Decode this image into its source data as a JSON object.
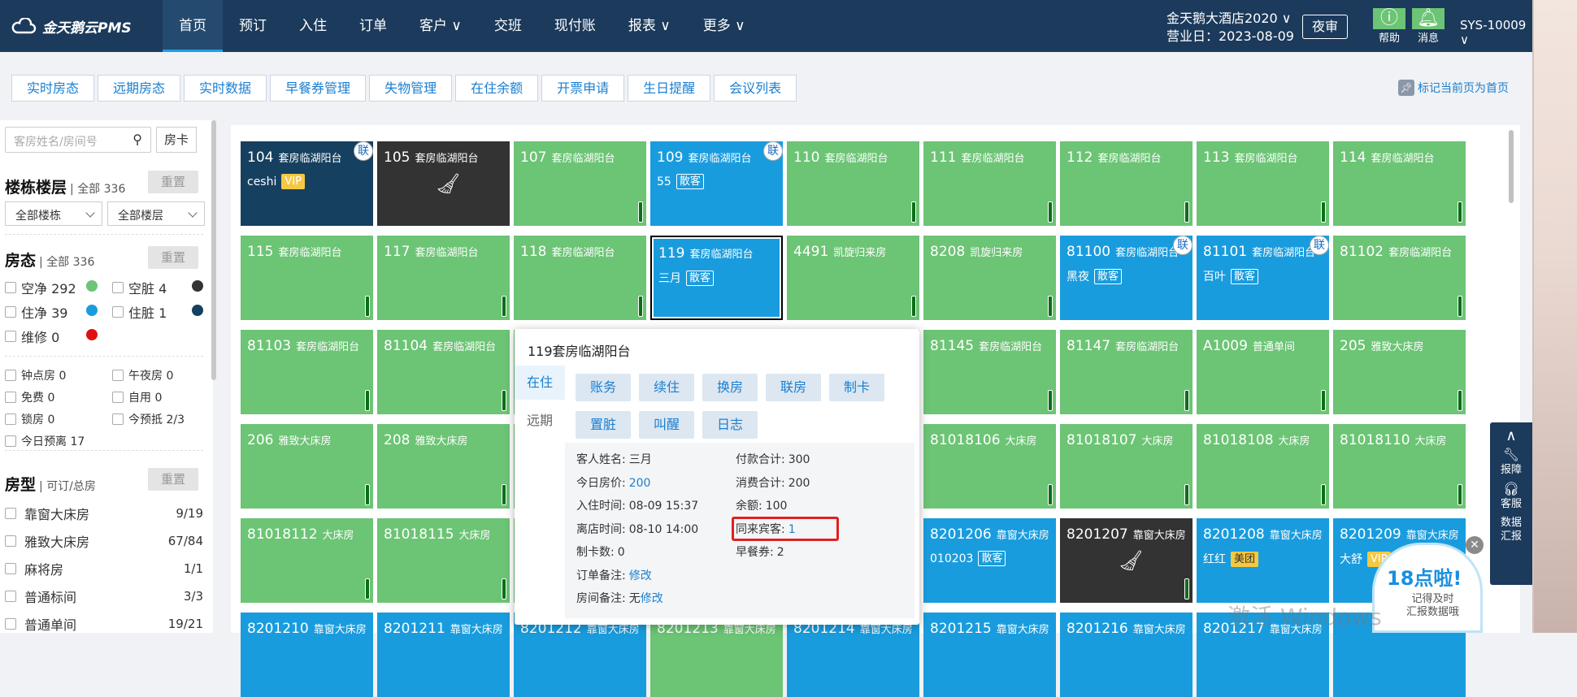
{
  "header": {
    "logo": "金天鹅云PMS",
    "nav": [
      {
        "label": "首页",
        "active": true
      },
      {
        "label": "预订"
      },
      {
        "label": "入住"
      },
      {
        "label": "订单"
      },
      {
        "label": "客户 ∨"
      },
      {
        "label": "交班"
      },
      {
        "label": "现付账"
      },
      {
        "label": "报表 ∨"
      },
      {
        "label": "更多 ∨"
      }
    ],
    "hotel_name": "金天鹅大酒店2020 ∨",
    "business_date": "营业日：2023-08-09",
    "night_audit": "夜审",
    "help": "帮助",
    "messages": "消息",
    "user": "SYS-10009 ∨"
  },
  "tabs": [
    "实时房态",
    "远期房态",
    "实时数据",
    "早餐券管理",
    "失物管理",
    "在住余额",
    "开票申请",
    "生日提醒",
    "会议列表"
  ],
  "pin_home": "标记当前页为首页",
  "sidebar": {
    "search_placeholder": "客房姓名/房间号",
    "room_card": "房卡",
    "building": {
      "title": "楼栋楼层",
      "total": "全部 336",
      "reset": "重置",
      "sel1": "全部楼栋",
      "sel2": "全部楼层"
    },
    "status": {
      "title": "房态",
      "total": "全部 336",
      "reset": "重置",
      "items": [
        {
          "label": "空净 292",
          "color": "#6cc475"
        },
        {
          "label": "空脏 4",
          "color": "#333333"
        },
        {
          "label": "住净 39",
          "color": "#199cde"
        },
        {
          "label": "住脏 1",
          "color": "#16405f"
        },
        {
          "label": "维修 0",
          "color": "#e01010"
        }
      ]
    },
    "flags": [
      "钟点房 0",
      "午夜房 0",
      "免费 0",
      "自用 0",
      "锁房 0",
      "今预抵 2/3",
      "今日预离 17"
    ],
    "room_type": {
      "title": "房型",
      "sub": "可订/总房",
      "reset": "重置",
      "items": [
        {
          "label": "靠窗大床房",
          "count": "9/19"
        },
        {
          "label": "雅致大床房",
          "count": "67/84"
        },
        {
          "label": "麻将房",
          "count": "1/1"
        },
        {
          "label": "普通标间",
          "count": "3/3"
        },
        {
          "label": "普通单间",
          "count": "19/21"
        }
      ]
    }
  },
  "rooms": [
    {
      "num": "104",
      "type": "套房临湖阳台",
      "style": "d",
      "guest": "ceshi",
      "tag": "VIP",
      "tagstyle": "vip",
      "lian": true,
      "bar": false
    },
    {
      "num": "105",
      "type": "套房临湖阳台",
      "style": "k",
      "broom": true,
      "bar": false
    },
    {
      "num": "107",
      "type": "套房临湖阳台",
      "style": "g",
      "bar": true
    },
    {
      "num": "109",
      "type": "套房临湖阳台",
      "style": "b",
      "guest": "55",
      "tag": "散客",
      "lian": true,
      "bar": false
    },
    {
      "num": "110",
      "type": "套房临湖阳台",
      "style": "g",
      "bar": true
    },
    {
      "num": "111",
      "type": "套房临湖阳台",
      "style": "g",
      "bar": true
    },
    {
      "num": "112",
      "type": "套房临湖阳台",
      "style": "g",
      "bar": true
    },
    {
      "num": "113",
      "type": "套房临湖阳台",
      "style": "g",
      "bar": true
    },
    {
      "num": "114",
      "type": "套房临湖阳台",
      "style": "g",
      "bar": true
    },
    {
      "num": "115",
      "type": "套房临湖阳台",
      "style": "g",
      "bar": true
    },
    {
      "num": "117",
      "type": "套房临湖阳台",
      "style": "g",
      "bar": true
    },
    {
      "num": "118",
      "type": "套房临湖阳台",
      "style": "g",
      "bar": true
    },
    {
      "num": "119",
      "type": "套房临湖阳台",
      "style": "b",
      "guest": "三月",
      "tag": "散客",
      "selected": true,
      "bar": false
    },
    {
      "num": "4491",
      "type": "凯旋归来房",
      "style": "g",
      "bar": true
    },
    {
      "num": "8208",
      "type": "凯旋归来房",
      "style": "g",
      "bar": true
    },
    {
      "num": "81100",
      "type": "套房临湖阳台",
      "style": "b",
      "guest": "黑夜",
      "tag": "散客",
      "lian": true,
      "bar": false
    },
    {
      "num": "81101",
      "type": "套房临湖阳台",
      "style": "b",
      "guest": "百叶",
      "tag": "散客",
      "lian": true,
      "bar": false
    },
    {
      "num": "81102",
      "type": "套房临湖阳台",
      "style": "g",
      "bar": true
    },
    {
      "num": "81103",
      "type": "套房临湖阳台",
      "style": "g",
      "bar": true
    },
    {
      "num": "81104",
      "type": "套房临湖阳台",
      "style": "g",
      "bar": true
    },
    {
      "num": "",
      "type": "",
      "style": "g",
      "bar": false
    },
    {
      "num": "",
      "type": "",
      "style": "g",
      "bar": false
    },
    {
      "num": "",
      "type": "",
      "style": "g",
      "bar": false
    },
    {
      "num": "81145",
      "type": "套房临湖阳台",
      "style": "g",
      "bar": true
    },
    {
      "num": "81147",
      "type": "套房临湖阳台",
      "style": "g",
      "bar": true
    },
    {
      "num": "A1009",
      "type": "普通单间",
      "style": "g",
      "bar": true
    },
    {
      "num": "205",
      "type": "雅致大床房",
      "style": "g",
      "bar": true
    },
    {
      "num": "206",
      "type": "雅致大床房",
      "style": "g",
      "bar": true
    },
    {
      "num": "208",
      "type": "雅致大床房",
      "style": "g",
      "bar": true
    },
    {
      "num": "",
      "type": "",
      "style": "g",
      "bar": false
    },
    {
      "num": "",
      "type": "",
      "style": "g",
      "bar": false
    },
    {
      "num": "",
      "type": "",
      "style": "g",
      "bar": false
    },
    {
      "num": "81018106",
      "type": "大床房",
      "style": "g",
      "bar": true
    },
    {
      "num": "81018107",
      "type": "大床房",
      "style": "g",
      "bar": true
    },
    {
      "num": "81018108",
      "type": "大床房",
      "style": "g",
      "bar": true
    },
    {
      "num": "81018110",
      "type": "大床房",
      "style": "g",
      "bar": true
    },
    {
      "num": "81018112",
      "type": "大床房",
      "style": "g",
      "bar": true
    },
    {
      "num": "81018115",
      "type": "大床房",
      "style": "g",
      "bar": true
    },
    {
      "num": "",
      "type": "",
      "style": "g",
      "bar": false
    },
    {
      "num": "",
      "type": "",
      "style": "g",
      "bar": false
    },
    {
      "num": "",
      "type": "",
      "style": "g",
      "bar": false
    },
    {
      "num": "8201206",
      "type": "靠窗大床房",
      "style": "b",
      "guest": "010203",
      "tag": "散客",
      "bar": false
    },
    {
      "num": "8201207",
      "type": "靠窗大床房",
      "style": "k",
      "broom": true,
      "bar": true
    },
    {
      "num": "8201208",
      "type": "靠窗大床房",
      "style": "b",
      "guest": "红红",
      "tag": "美团",
      "tagstyle": "mt",
      "bar": false
    },
    {
      "num": "8201209",
      "type": "靠窗大床房",
      "style": "b",
      "guest": "大舒",
      "tag": "VIP",
      "tagstyle": "vip",
      "bar": false
    },
    {
      "num": "8201210",
      "type": "靠窗大床房",
      "style": "b",
      "bar": false
    },
    {
      "num": "8201211",
      "type": "靠窗大床房",
      "style": "b",
      "bar": false
    },
    {
      "num": "8201212",
      "type": "靠窗大床房",
      "style": "b",
      "bar": false
    },
    {
      "num": "8201213",
      "type": "靠窗大床房",
      "style": "g",
      "bar": false
    },
    {
      "num": "8201214",
      "type": "靠窗大床房",
      "style": "b",
      "bar": false
    },
    {
      "num": "8201215",
      "type": "靠窗大床房",
      "style": "b",
      "bar": false
    },
    {
      "num": "8201216",
      "type": "靠窗大床房",
      "style": "b",
      "bar": false
    },
    {
      "num": "8201217",
      "type": "靠窗大床房",
      "style": "b",
      "bar": false
    },
    {
      "num": "",
      "type": "",
      "style": "b",
      "bar": false
    }
  ],
  "popup": {
    "title": "119套房临湖阳台",
    "tabs": [
      "在住",
      "远期"
    ],
    "actions": [
      "账务",
      "续住",
      "换房",
      "联房",
      "制卡",
      "置脏",
      "叫醒",
      "日志"
    ],
    "left": [
      {
        "k": "客人姓名:",
        "v": "三月"
      },
      {
        "k": "今日房价:",
        "v": "200",
        "link": true
      },
      {
        "k": "入住时间:",
        "v": "08-09 15:37"
      },
      {
        "k": "离店时间:",
        "v": "08-10 14:00"
      },
      {
        "k": "制卡数:",
        "v": "0"
      },
      {
        "k": "订单备注:",
        "v": "修改",
        "link": true
      },
      {
        "k": "房间备注:",
        "v": "无",
        "link2": "修改"
      }
    ],
    "right": [
      {
        "k": "付款合计:",
        "v": "300"
      },
      {
        "k": "消费合计:",
        "v": "200"
      },
      {
        "k": "余额:",
        "v": "100"
      },
      {
        "k": "同来宾客:",
        "v": "1",
        "link": true
      },
      {
        "k": "早餐券:",
        "v": "2"
      }
    ]
  },
  "right_tools": {
    "up": "∧",
    "fault": "报障",
    "service": "客服",
    "report": "数据汇报"
  },
  "promo": {
    "title": "18点啦!",
    "line1": "记得及时",
    "line2": "汇报数据哦"
  },
  "watermark": "激活 Windows"
}
